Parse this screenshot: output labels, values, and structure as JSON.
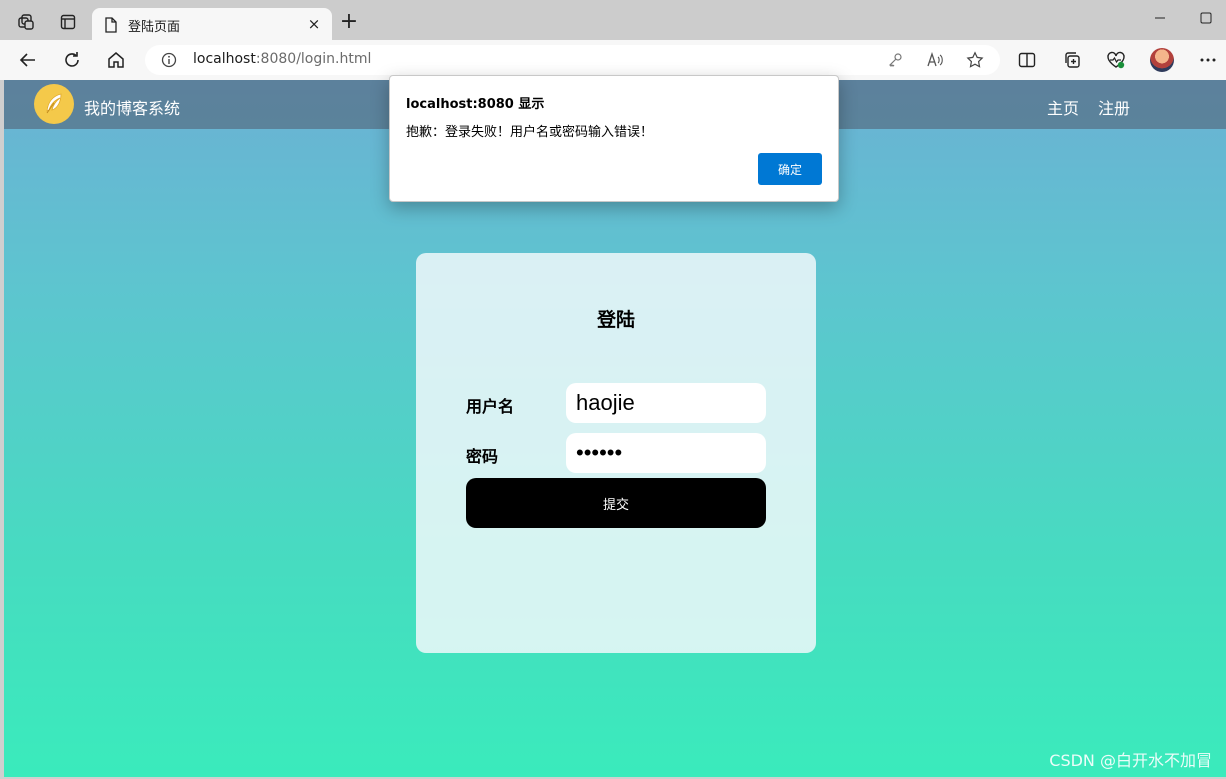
{
  "browser": {
    "tab_title": "登陆页面",
    "tab_close": "×",
    "new_tab": "+",
    "url_host": "localhost",
    "url_rest": ":8080/login.html",
    "icons": [
      "workspaces-icon",
      "tab-actions-icon",
      "page-icon",
      "close-icon",
      "new-tab-icon",
      "minimize-icon",
      "maximize-icon",
      "back-icon",
      "refresh-icon",
      "home-icon",
      "info-icon",
      "key-icon",
      "read-aloud-icon",
      "favorite-star-icon",
      "split-screen-icon",
      "collections-icon",
      "browser-essentials-icon",
      "profile-avatar",
      "more-icon"
    ]
  },
  "site": {
    "title": "我的博客系统",
    "nav": {
      "home": "主页",
      "register": "注册"
    }
  },
  "login": {
    "heading": "登陆",
    "username_label": "用户名",
    "username_value": "haojie",
    "password_label": "密码",
    "password_value": "••••••",
    "submit_label": "提交"
  },
  "dialog": {
    "title": "localhost:8080 显示",
    "message": "抱歉：登录失败！用户名或密码输入错误！",
    "ok_label": "确定"
  },
  "watermark": "CSDN @白开水不加冒",
  "colors": {
    "gradient_top": "#6bb1d4",
    "gradient_bottom": "#3aebbc",
    "dialog_button": "#0078d4",
    "logo": "#f4c94a"
  }
}
